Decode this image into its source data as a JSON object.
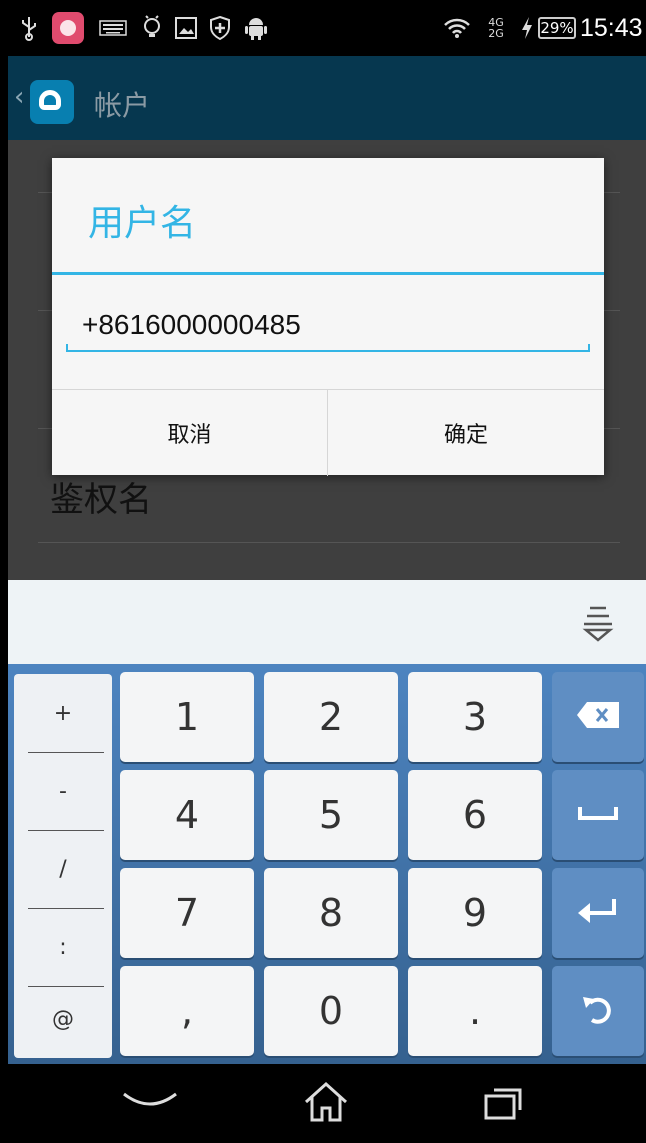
{
  "status_bar": {
    "battery": "29%",
    "signal_top": "4G",
    "signal_bottom": "2G",
    "time": "15:43"
  },
  "action_bar": {
    "title": "帐户"
  },
  "background": {
    "auth_label": "鉴权名"
  },
  "dialog": {
    "title": "用户名",
    "input_value": "+8616000000485",
    "cancel_label": "取消",
    "ok_label": "确定"
  },
  "keyboard": {
    "symbols": [
      "+",
      "-",
      "/",
      ":",
      "@"
    ],
    "rows": [
      [
        "1",
        "2",
        "3"
      ],
      [
        "4",
        "5",
        "6"
      ],
      [
        "7",
        "8",
        "9"
      ],
      [
        ",",
        "0",
        "."
      ]
    ],
    "function_keys": [
      "backspace-icon",
      "space-icon",
      "enter-icon",
      "undo-icon"
    ],
    "accent_color": "#33b5e5"
  },
  "nav_bar": {
    "icons": [
      "back-icon",
      "home-icon",
      "recents-icon"
    ]
  }
}
